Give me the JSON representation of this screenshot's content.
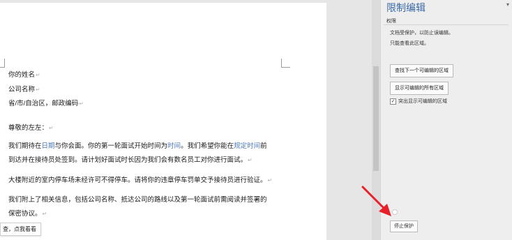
{
  "document": {
    "lines": [
      {
        "text": "你的姓名"
      },
      {
        "text": "公司名称"
      },
      {
        "text": "省/市/自治区，邮政编码"
      },
      {
        "text": "尊敬的左左："
      }
    ],
    "para1": {
      "a": "我们期待在",
      "b": "日期",
      "c": "与你会面。你的第一轮面试开始时间为",
      "d": "时间",
      "e": "。我们希望你能在",
      "f": "规定时间",
      "g": "前"
    },
    "para1_line2": "到达并在接待员处签到。请计划好面试时长因为我们会有数名员工对你进行面试。",
    "para2": "大楼附近的室内停车场未经许可不得停车。请将你的违章停车罚单交予接待员进行验证。",
    "para3_line1": "我们附上了相关信息，包括公司名称、抵达公司的路线以及第一轮面试前需阅读并签署的",
    "para3_line2": "保密协议。",
    "paragraph_mark": "↵",
    "tooltip": "查，点我看看"
  },
  "pane": {
    "title": "限制编辑",
    "close": "▾",
    "subhead": "权限",
    "info_line1": "文档受保护，以防止误编辑。",
    "info_line2": "只能查看此区域。",
    "find_next_button": "查找下一个可编辑的区域",
    "show_all_button": "显示可编辑的所有区域",
    "highlight_checkbox": "突出显示可编辑的区域",
    "highlight_checked": true,
    "checkmark": "✓",
    "stop_protection_button": "停止保护"
  },
  "annotation": {
    "arrow_color": "#e8202a"
  }
}
